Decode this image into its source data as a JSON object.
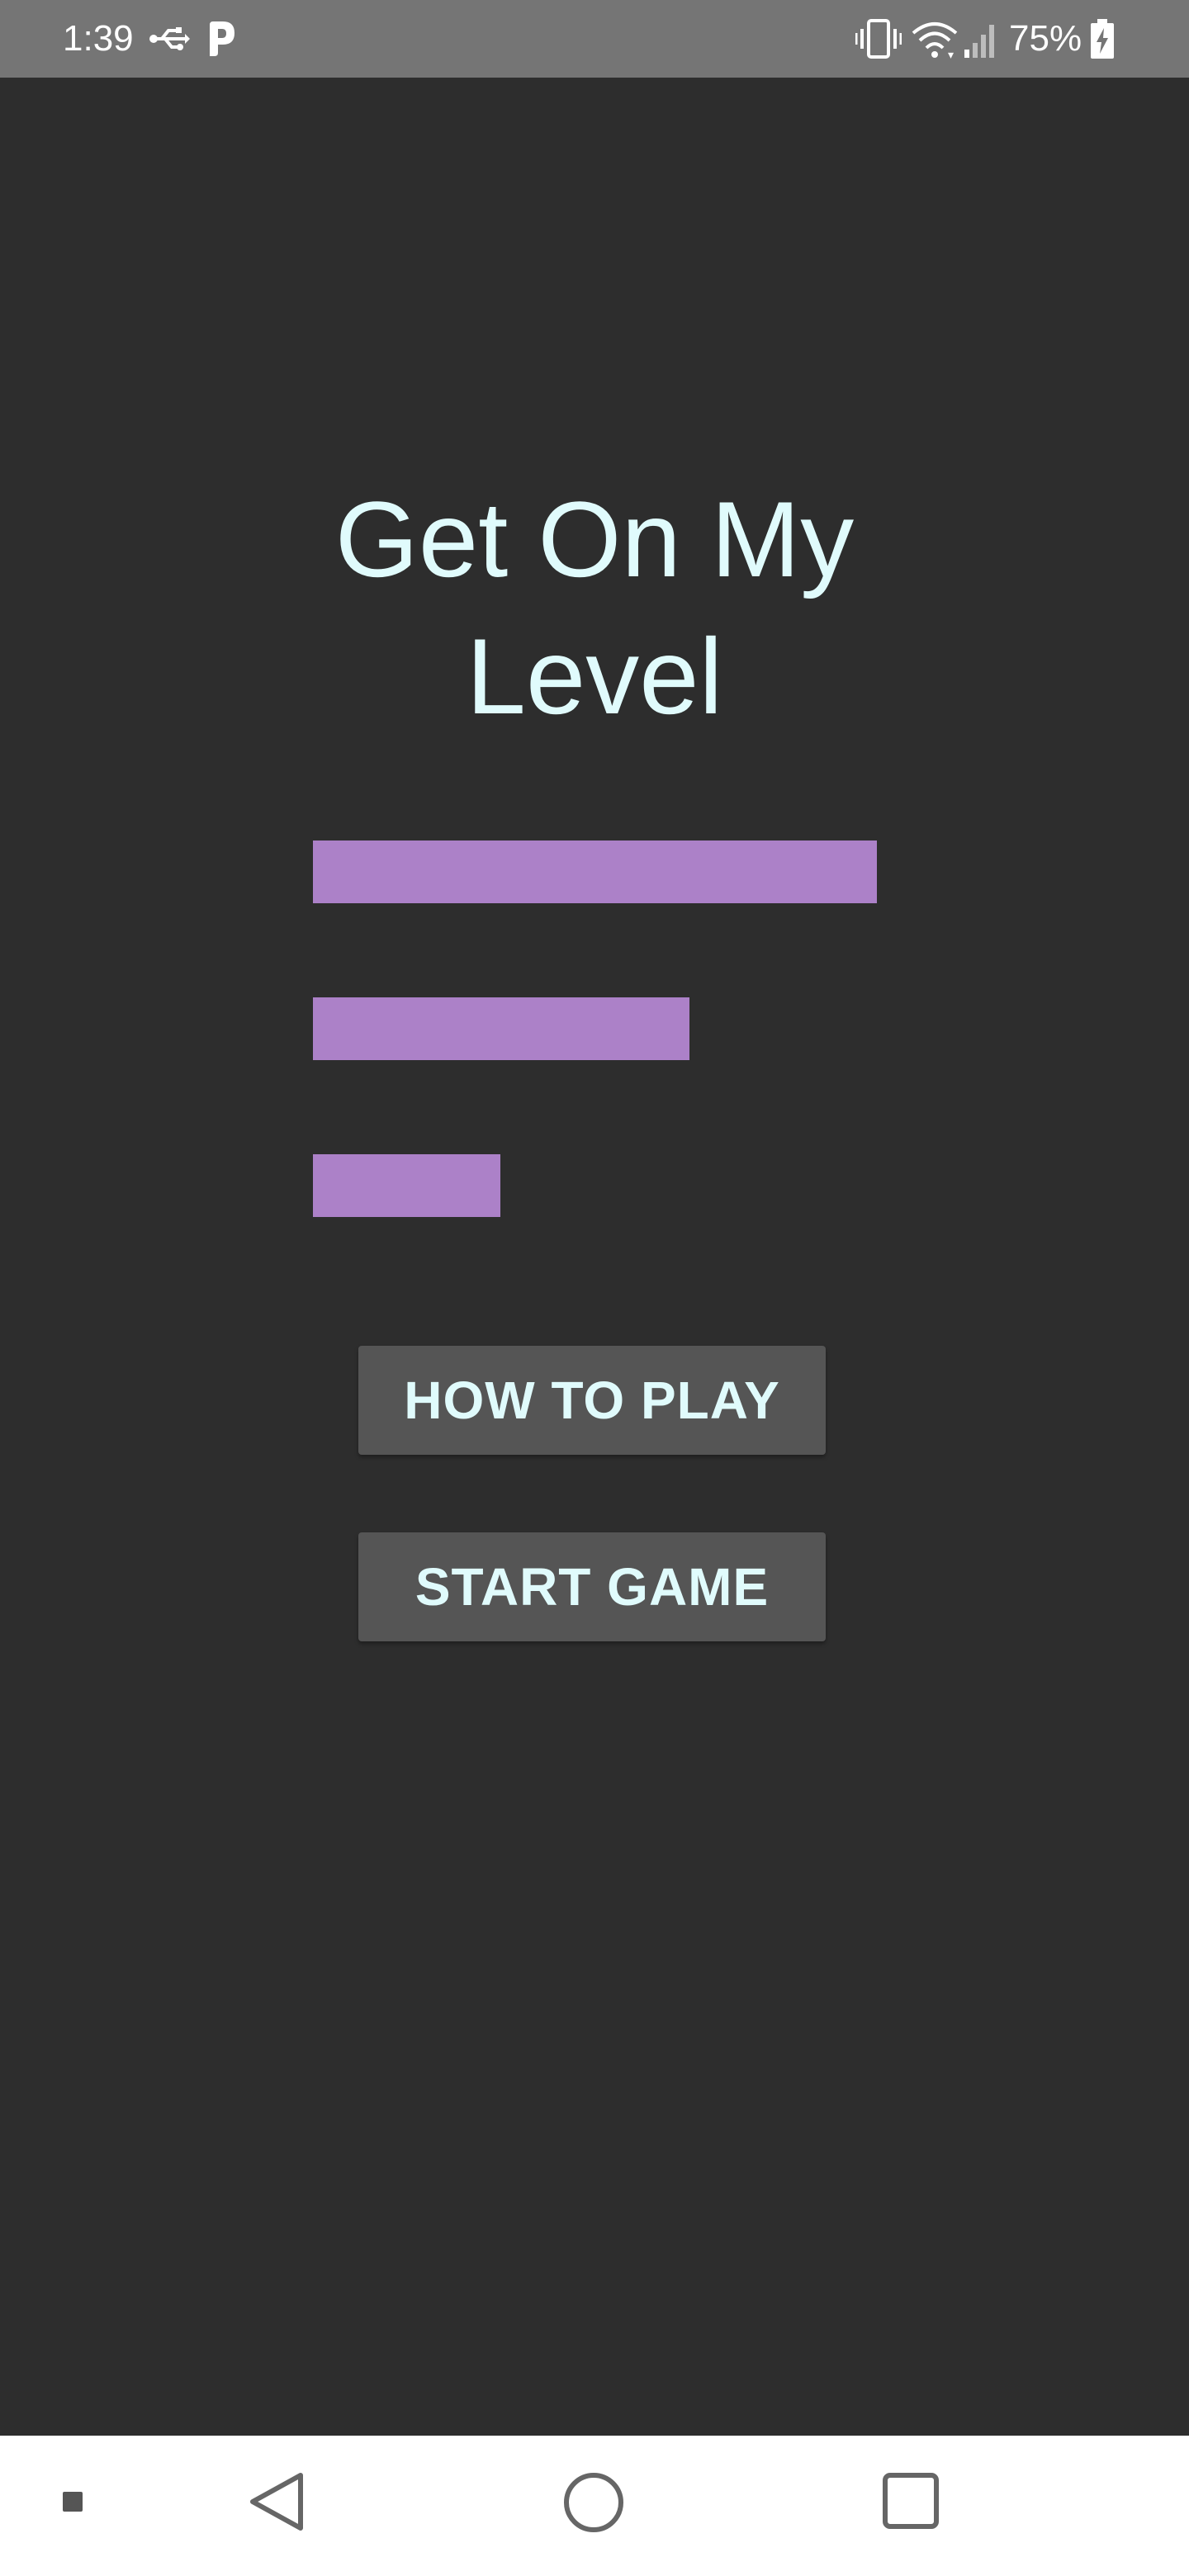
{
  "status_bar": {
    "time": "1:39",
    "battery_percent": "75%",
    "icons": [
      "usb-icon",
      "parking-app-icon",
      "vibrate-icon",
      "wifi-icon",
      "cell-signal-icon",
      "battery-charging-icon"
    ]
  },
  "main": {
    "title_line1": "Get On My",
    "title_line2": "Level",
    "level_bars": [
      {
        "fill": 1.0
      },
      {
        "fill": 0.667
      },
      {
        "fill": 0.333
      }
    ],
    "how_to_play_label": "HOW TO PLAY",
    "start_game_label": "START GAME"
  },
  "colors": {
    "background": "#2d2d2d",
    "status_bar": "#757575",
    "title_text": "#e0fbfc",
    "level_bar": "#ac81c8",
    "button": "#555555",
    "nav_bar": "#ffffff"
  },
  "nav_bar": {
    "icons": [
      "menu-dot-icon",
      "back-icon",
      "home-icon",
      "recents-icon"
    ]
  }
}
